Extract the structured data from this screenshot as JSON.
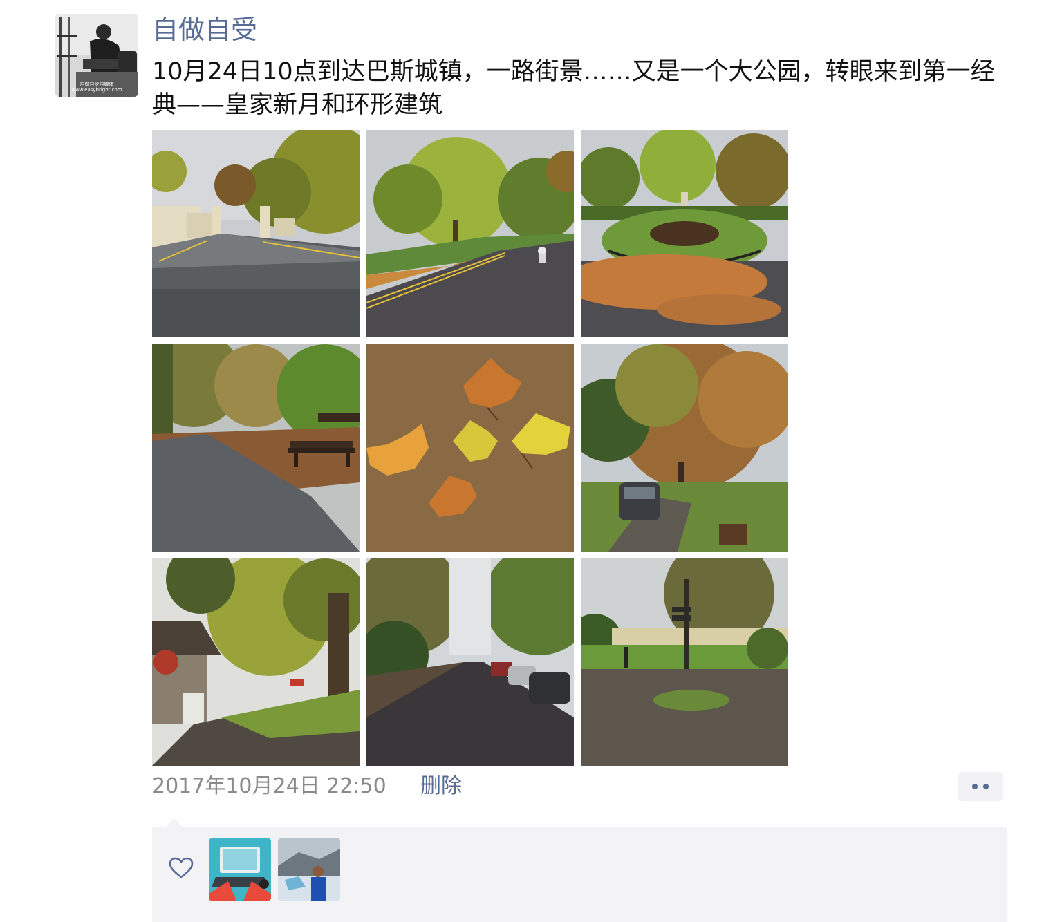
{
  "post": {
    "author": "自做自受",
    "avatar_caption": "自做自受自媒体 www.easybright.com",
    "text": "10月24日10点到达巴斯城镇，一路街景……又是一个大公园，转眼来到第一经典——皇家新月和环形建筑",
    "photos": [
      {
        "name": "park-gate-road",
        "icon": "photo-thumbnail"
      },
      {
        "name": "tree-lined-road-cyclist",
        "icon": "photo-thumbnail"
      },
      {
        "name": "fenced-flowerbed-fallen-leaves",
        "icon": "photo-thumbnail"
      },
      {
        "name": "path-with-benches",
        "icon": "photo-thumbnail"
      },
      {
        "name": "yellow-leaves-on-ground",
        "icon": "photo-thumbnail"
      },
      {
        "name": "autumn-tree-parked-car",
        "icon": "photo-thumbnail"
      },
      {
        "name": "cottage-autumn-trees",
        "icon": "photo-thumbnail"
      },
      {
        "name": "street-with-parked-cars",
        "icon": "photo-thumbnail"
      },
      {
        "name": "royal-crescent-lawn",
        "icon": "photo-thumbnail"
      }
    ],
    "timestamp": "2017年10月24日 22:50",
    "delete_label": "删除",
    "more_icon": "more-dots-icon"
  },
  "likes": {
    "icon": "heart-outline-icon",
    "likers": [
      {
        "name": "liker-laptop-illustration"
      },
      {
        "name": "liker-glacier-photo"
      }
    ]
  },
  "colors": {
    "link": "#576b95",
    "text": "#111111",
    "meta": "#8a8a8a",
    "panel": "#f3f3f5"
  }
}
